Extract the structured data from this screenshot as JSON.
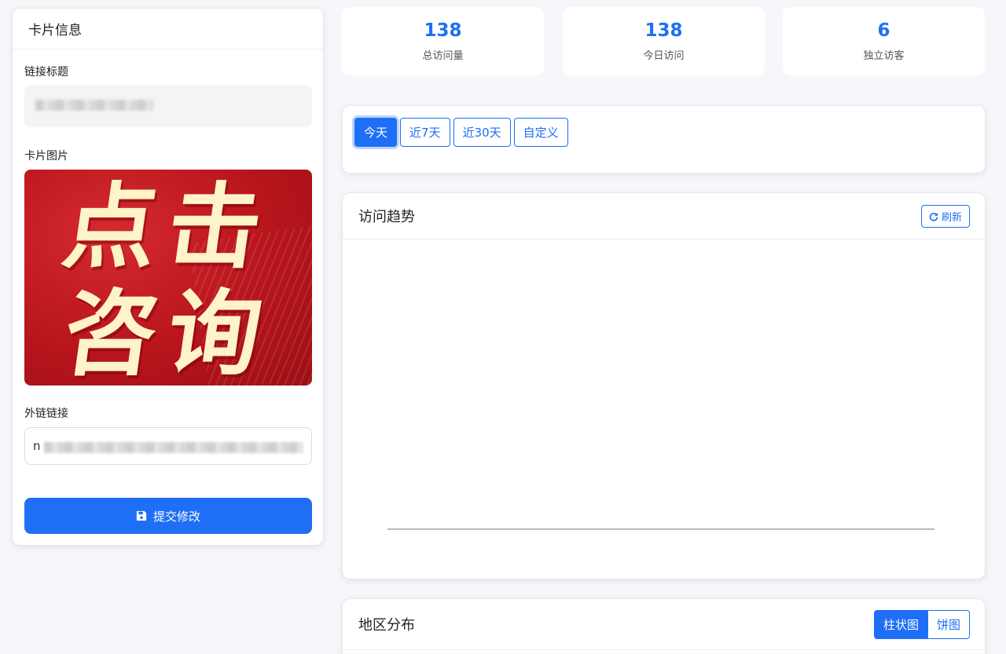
{
  "card_info": {
    "title": "卡片信息",
    "link_title_label": "链接标题",
    "card_image_label": "卡片图片",
    "promo_line1": "点击",
    "promo_line2": "咨询",
    "external_link_label": "外链链接",
    "external_link_prefix": "n",
    "submit_label": "提交修改"
  },
  "stats": [
    {
      "value": "138",
      "label": "总访问量"
    },
    {
      "value": "138",
      "label": "今日访问"
    },
    {
      "value": "6",
      "label": "独立访客"
    }
  ],
  "range": {
    "buttons": [
      "今天",
      "近7天",
      "近30天",
      "自定义"
    ],
    "active": "今天"
  },
  "trend": {
    "title": "访问趋势",
    "refresh_label": "刷新"
  },
  "region": {
    "title": "地区分布",
    "toggle_bar": "柱状图",
    "toggle_pie": "饼图"
  },
  "colors": {
    "accent": "#1e6ff5",
    "promo_red": "#b8151c",
    "promo_text": "#fff3c9"
  },
  "icons": {
    "save": "floppy-disk-icon",
    "refresh": "refresh-icon"
  }
}
